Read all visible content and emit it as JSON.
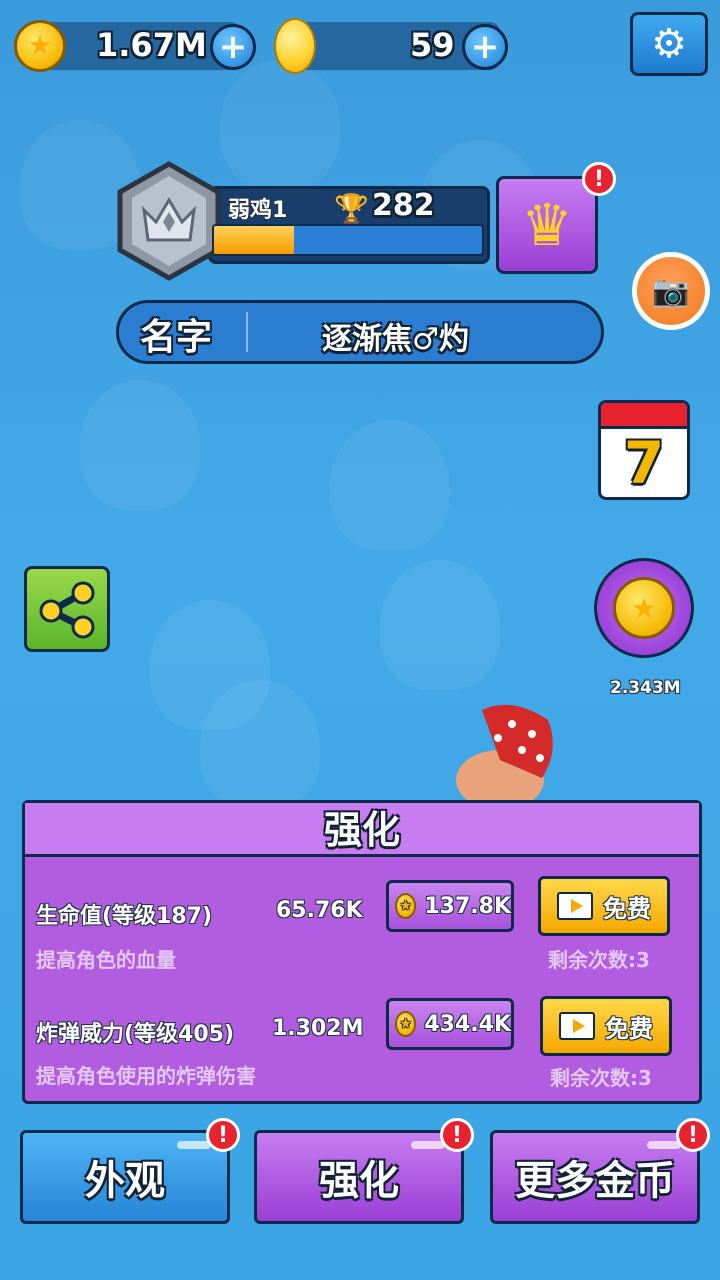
{
  "currency": {
    "coins": "1.67M",
    "gems": "59"
  },
  "rank": {
    "name": "弱鸡1",
    "score": "282",
    "progress": 0.3
  },
  "name_bar": {
    "label": "名字",
    "value": "逐渐焦♂灼"
  },
  "calendar": {
    "day": "7"
  },
  "offline": {
    "value": "2.343M"
  },
  "panel": {
    "title": "强化",
    "rows": [
      {
        "title": "生命值(等级187)",
        "value": "65.76K",
        "desc": "提高角色的血量",
        "cost": "137.8K",
        "free_label": "免费",
        "remaining": "剩余次数:3"
      },
      {
        "title": "炸弹威力(等级405)",
        "value": "1.302M",
        "desc": "提高角色使用的炸弹伤害",
        "cost": "434.4K",
        "free_label": "免费",
        "remaining": "剩余次数:3"
      }
    ]
  },
  "nav": {
    "appearance": "外观",
    "upgrade": "强化",
    "more_coins": "更多金币"
  },
  "alert_mark": "!",
  "colors": {
    "accent_blue": "#2585d8",
    "accent_purple": "#b25ddf",
    "gold": "#f5b800",
    "alert_red": "#e8222f"
  }
}
